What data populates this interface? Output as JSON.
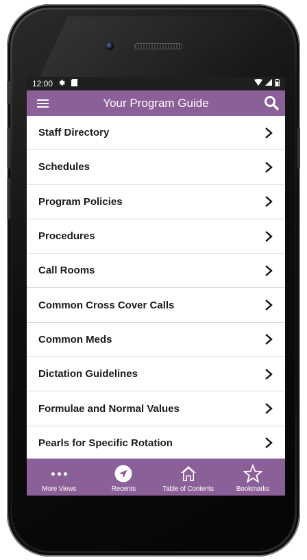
{
  "status_bar": {
    "time": "12:00",
    "settings_icon": "gear-icon",
    "sd_icon": "sd-card-icon",
    "wifi_icon": "wifi-icon",
    "signal_icon": "signal-icon",
    "battery_icon": "battery-icon"
  },
  "app_bar": {
    "title": "Your Program Guide",
    "menu_icon": "hamburger-icon",
    "search_icon": "search-icon",
    "color": "#8b5f97"
  },
  "menu": {
    "items": [
      {
        "label": "Staff Directory"
      },
      {
        "label": "Schedules"
      },
      {
        "label": "Program Policies"
      },
      {
        "label": "Procedures"
      },
      {
        "label": "Call Rooms"
      },
      {
        "label": "Common Cross Cover Calls"
      },
      {
        "label": "Common Meds"
      },
      {
        "label": "Dictation Guidelines"
      },
      {
        "label": "Formulae and Normal Values"
      },
      {
        "label": "Pearls for Specific Rotation"
      }
    ]
  },
  "bottom_nav": {
    "items": [
      {
        "label": "More Views",
        "icon": "more-dots-icon"
      },
      {
        "label": "Recents",
        "icon": "navigation-arrow-icon"
      },
      {
        "label": "Table of Contents",
        "icon": "home-icon"
      },
      {
        "label": "Bookmarks",
        "icon": "star-icon"
      }
    ]
  }
}
